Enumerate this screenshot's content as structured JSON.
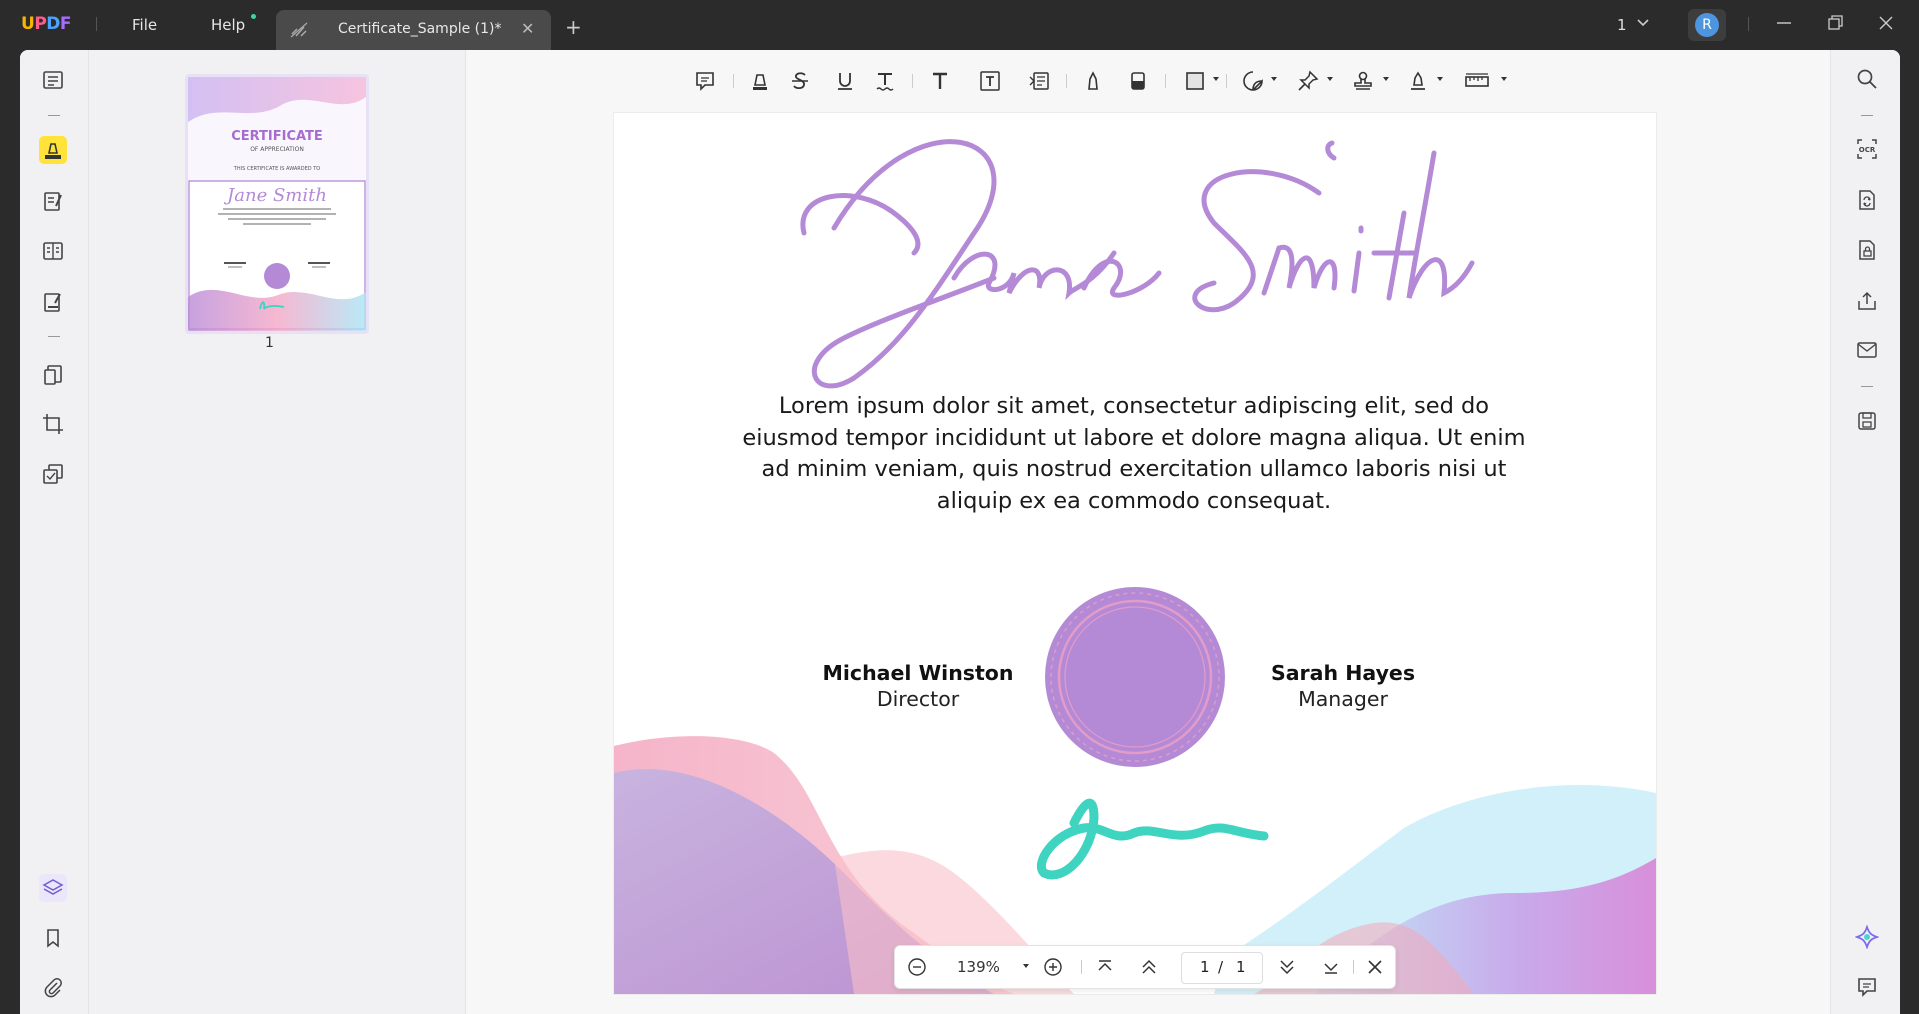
{
  "app": {
    "logo": "UPDF",
    "menu": {
      "file": "File",
      "help": "Help"
    },
    "tab_title": "Certificate_Sample (1)*",
    "page_indicator": "1",
    "avatar_letter": "R"
  },
  "thumbnails": [
    {
      "label": "1",
      "title": "CERTIFICATE",
      "subtitle": "OF APPRECIATION",
      "awarded": "THIS CERTIFICATE IS AWARDED TO",
      "name": "Jane Smith"
    }
  ],
  "certificate": {
    "recipient": "Jane Smith",
    "body": "Lorem ipsum dolor sit amet, consectetur adipiscing elit, sed do eiusmod tempor incididunt ut labore et dolore magna aliqua. Ut enim ad minim veniam, quis nostrud exercitation ullamco laboris nisi ut aliquip ex ea commodo consequat.",
    "left_person": {
      "name": "Michael Winston",
      "role": "Director"
    },
    "right_person": {
      "name": "Sarah Hayes",
      "role": "Manager"
    }
  },
  "navigation": {
    "zoom": "139%",
    "current_page": "1",
    "page_separator": "/",
    "total_pages": "1"
  },
  "colors": {
    "accent_purple": "#b18ad6",
    "seal": "#b48ad6",
    "signature_teal": "#3ed4c0",
    "highlight_tool": "#ffe23a"
  }
}
